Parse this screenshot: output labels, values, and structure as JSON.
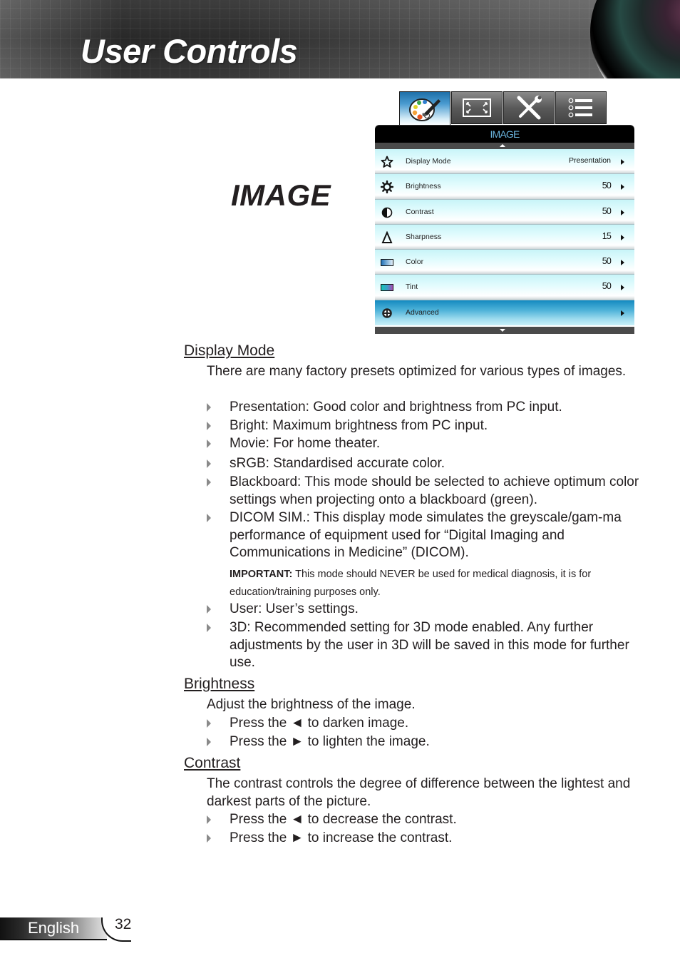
{
  "header": {
    "title": "User Controls"
  },
  "section": {
    "title": "IMAGE"
  },
  "osd": {
    "tabs": [
      {
        "name": "image",
        "icon": "palette-icon",
        "active": true
      },
      {
        "name": "display",
        "icon": "screen-resize-icon",
        "active": false
      },
      {
        "name": "setup",
        "icon": "tools-icon",
        "active": false
      },
      {
        "name": "options",
        "icon": "list-icon",
        "active": false
      }
    ],
    "menu_title": "IMAGE",
    "accent_color": "#6ab4de",
    "rows": [
      {
        "label": "Display Mode",
        "value": "Presentation",
        "icon": "star-icon"
      },
      {
        "label": "Brightness",
        "value": "50",
        "icon": "sun-icon"
      },
      {
        "label": "Contrast",
        "value": "50",
        "icon": "contrast-icon"
      },
      {
        "label": "Sharpness",
        "value": "15",
        "icon": "sharpness-triangle-icon"
      },
      {
        "label": "Color",
        "value": "50",
        "icon": "color-gradient-icon"
      },
      {
        "label": "Tint",
        "value": "50",
        "icon": "tint-gradient-icon"
      },
      {
        "label": "Advanced",
        "value": "",
        "icon": "advanced-crosshair-icon",
        "selected": true
      }
    ]
  },
  "content": {
    "display_mode": {
      "heading": "Display Mode",
      "intro": "There are many factory presets optimized for various types of images.",
      "bullets": [
        "Presentation: Good color and brightness from PC input.",
        "Bright: Maximum brightness from PC input.",
        "Movie: For home theater.",
        "sRGB: Standardised accurate color.",
        "Blackboard: This mode should be selected to achieve optimum color settings when projecting onto a blackboard (green).",
        "DICOM SIM.: This display mode simulates the greyscale/gam-ma performance of equipment used for “Digital Imaging and Communications in Medicine” (DICOM).",
        "User: User’s settings.",
        "3D: Recommended setting for 3D mode enabled. Any further adjustments by the user in 3D will be saved in this mode for further use."
      ],
      "important_label": "IMPORTANT:",
      "important_text": " This mode should NEVER be used for medical diagnosis, it is for education/training purposes only."
    },
    "brightness": {
      "heading": "Brightness",
      "intro": "Adjust the brightness of the image.",
      "bullets": [
        "Press the ◄ to darken image.",
        "Press the ► to lighten the image."
      ]
    },
    "contrast": {
      "heading": "Contrast",
      "intro": "The contrast controls the degree of difference between the lightest and darkest parts of the picture.",
      "bullets": [
        "Press the ◄ to decrease the contrast.",
        "Press the ► to increase the contrast."
      ]
    }
  },
  "footer": {
    "language": "English",
    "page_number": "32"
  }
}
